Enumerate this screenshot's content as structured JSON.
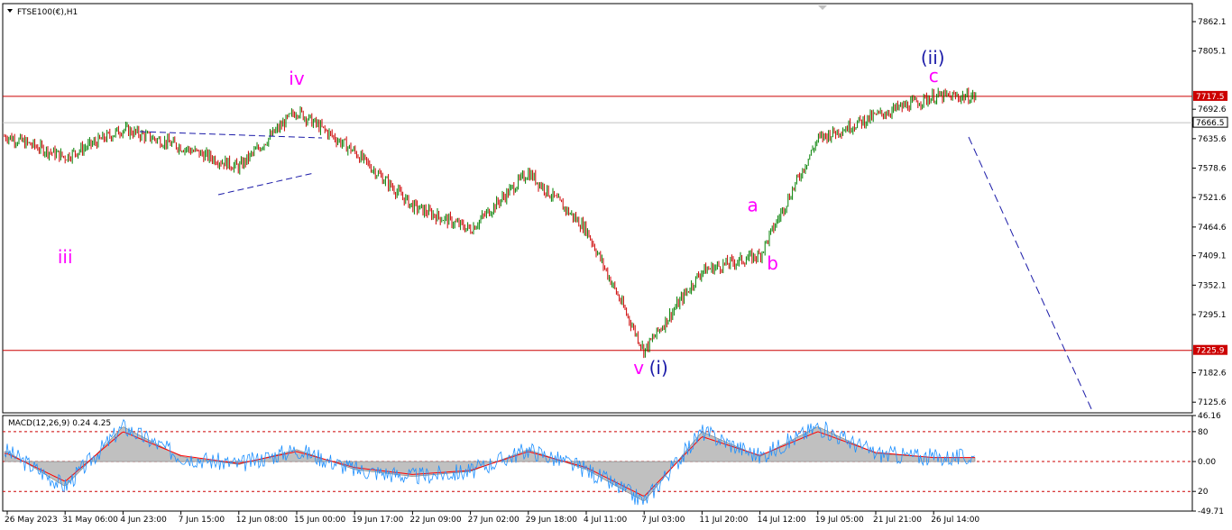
{
  "chart_data": [
    {
      "type": "line",
      "title": "FTSE100(€),H1",
      "symbol": "FTSE100(€)",
      "timeframe": "H1",
      "price_ticks": [
        "7862.1",
        "7805.1",
        "7692.6",
        "7635.6",
        "7578.6",
        "7521.6",
        "7464.6",
        "7409.1",
        "7352.1",
        "7295.1",
        "7182.6",
        "7125.6"
      ],
      "price_range": [
        7105,
        7897
      ],
      "time_ticks": [
        "26 May 2023",
        "31 May 06:00",
        "4 Jun 23:00",
        "7 Jun 15:00",
        "12 Jun 08:00",
        "15 Jun 00:00",
        "19 Jun 17:00",
        "22 Jun 09:00",
        "27 Jun 02:00",
        "29 Jun 18:00",
        "4 Jul 11:00",
        "7 Jul 03:00",
        "11 Jul 20:00",
        "14 Jul 12:00",
        "19 Jul 05:00",
        "21 Jul 21:00",
        "26 Jul 14:00"
      ],
      "series": [
        {
          "name": "",
          "x": [
            "26 May 2023",
            "31 May 06:00",
            "4 Jun 23:00",
            "7 Jun 15:00",
            "12 Jun 08:00",
            "15 Jun 00:00",
            "19 Jun 17:00",
            "22 Jun 09:00",
            "27 Jun 02:00",
            "29 Jun 18:00",
            "4 Jul 11:00",
            "7 Jul 03:00",
            "11 Jul 20:00",
            "14 Jul 12:00",
            "19 Jul 05:00",
            "21 Jul 21:00",
            "26 Jul 14:00"
          ],
          "values": [
            7640,
            7600,
            7654,
            7620,
            7580,
            7690,
            7610,
            7505,
            7460,
            7570,
            7460,
            7225,
            7380,
            7410,
            7635,
            7680,
            7717
          ]
        }
      ],
      "levels": [
        {
          "label": "7717.5",
          "value": 7717.5,
          "color": "#cc0000"
        },
        {
          "label": "7666.5",
          "value": 7666.5,
          "color": "#c0c0c0"
        },
        {
          "label": "7225.9",
          "value": 7225.9,
          "color": "#cc0000"
        }
      ],
      "wave_labels": [
        {
          "text": "iii",
          "date": "31 May 06:00",
          "price": 7395,
          "color": "#ff00ff"
        },
        {
          "text": "iv",
          "date": "15 Jun 00:00",
          "price": 7740,
          "color": "#ff00ff"
        },
        {
          "text": "v",
          "date": "7 Jul 03:00",
          "price": 7180,
          "color": "#ff00ff"
        },
        {
          "text": "(i)",
          "date": "7 Jul 03:00",
          "price": 7180,
          "color": "#1a1aa8"
        },
        {
          "text": "a",
          "date": "14 Jul 12:00",
          "price": 7495,
          "color": "#ff00ff"
        },
        {
          "text": "b",
          "date": "14 Jul 12:00",
          "price": 7382,
          "color": "#ff00ff"
        },
        {
          "text": "c",
          "date": "26 Jul 14:00",
          "price": 7745,
          "color": "#ff00ff"
        },
        {
          "text": "(ii)",
          "date": "26 Jul 14:00",
          "price": 7780,
          "color": "#1a1aa8"
        }
      ],
      "colors": {
        "up": "#008000",
        "down": "#cc0000",
        "trendline": "#1a1aa8"
      }
    },
    {
      "type": "area",
      "title": "MACD(12,26,9) 0.24 4.25",
      "macd_value": "0.24",
      "signal_value": "4.25",
      "ticks": [
        "46.16",
        "80",
        "0.00",
        "20",
        "-49.71"
      ],
      "range": [
        -49.71,
        46.16
      ],
      "levels": [
        30,
        0,
        -30
      ],
      "series": [
        {
          "name": "",
          "color": "#c0c0c0",
          "x": [
            "26 May 2023",
            "31 May 06:00",
            "4 Jun 23:00",
            "7 Jun 15:00",
            "12 Jun 08:00",
            "15 Jun 00:00",
            "19 Jun 17:00",
            "22 Jun 09:00",
            "27 Jun 02:00",
            "29 Jun 18:00",
            "4 Jul 11:00",
            "7 Jul 03:00",
            "11 Jul 20:00",
            "14 Jul 12:00",
            "19 Jul 05:00",
            "21 Jul 21:00",
            "26 Jul 14:00"
          ],
          "values": [
            10,
            -25,
            35,
            5,
            -3,
            12,
            -8,
            -15,
            -10,
            12,
            -8,
            -40,
            30,
            5,
            35,
            8,
            4
          ]
        },
        {
          "name": "",
          "color": "#ff0000",
          "x": [
            "26 May 2023",
            "31 May 06:00",
            "4 Jun 23:00",
            "7 Jun 15:00",
            "12 Jun 08:00",
            "15 Jun 00:00",
            "19 Jun 17:00",
            "22 Jun 09:00",
            "27 Jun 02:00",
            "29 Jun 18:00",
            "4 Jul 11:00",
            "7 Jul 03:00",
            "11 Jul 20:00",
            "14 Jul 12:00",
            "19 Jul 05:00",
            "21 Jul 21:00",
            "26 Jul 14:00"
          ],
          "values": [
            8,
            -20,
            30,
            6,
            -2,
            10,
            -6,
            -13,
            -9,
            10,
            -6,
            -35,
            25,
            6,
            30,
            9,
            4
          ]
        }
      ]
    }
  ]
}
